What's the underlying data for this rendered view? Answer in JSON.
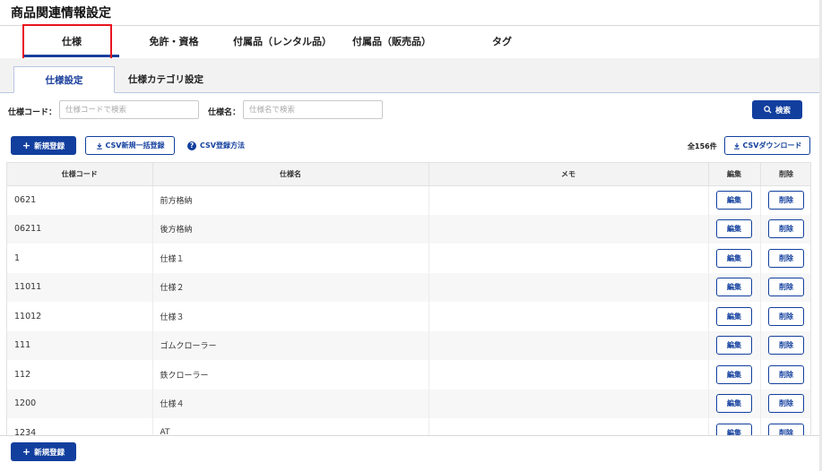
{
  "page": {
    "title": "商品関連情報設定"
  },
  "top_tabs": [
    {
      "label": "仕様"
    },
    {
      "label": "免許・資格"
    },
    {
      "label": "付属品（レンタル品）"
    },
    {
      "label": "付属品（販売品）"
    },
    {
      "label": "タグ"
    }
  ],
  "sub_tabs": [
    {
      "label": "仕様設定"
    },
    {
      "label": "仕様カテゴリ設定"
    }
  ],
  "search": {
    "code_label": "仕様コード：",
    "code_placeholder": "仕様コードで検索",
    "name_label": "仕様名：",
    "name_placeholder": "仕様名で検索",
    "button_label": "検索"
  },
  "toolbar": {
    "new_label": "新規登録",
    "csv_bulk_label": "CSV新規一括登録",
    "csv_help_label": "CSV登録方法",
    "count_text": "全156件",
    "csv_download_label": "CSVダウンロード"
  },
  "table": {
    "headers": {
      "code": "仕様コード",
      "name": "仕様名",
      "memo": "メモ",
      "edit": "編集",
      "delete": "削除"
    },
    "edit_label": "編集",
    "delete_label": "削除",
    "rows": [
      {
        "code": "0621",
        "name": "前方格納",
        "memo": ""
      },
      {
        "code": "06211",
        "name": "後方格納",
        "memo": ""
      },
      {
        "code": "1",
        "name": "仕様１",
        "memo": ""
      },
      {
        "code": "11011",
        "name": "仕様２",
        "memo": ""
      },
      {
        "code": "11012",
        "name": "仕様３",
        "memo": ""
      },
      {
        "code": "111",
        "name": "ゴムクローラー",
        "memo": ""
      },
      {
        "code": "112",
        "name": "鉄クローラー",
        "memo": ""
      },
      {
        "code": "1200",
        "name": "仕様４",
        "memo": ""
      },
      {
        "code": "1234",
        "name": "AT",
        "memo": ""
      }
    ]
  },
  "footer": {
    "new_label": "新規登録"
  },
  "icons": {
    "plus": "plus-icon",
    "download": "download-icon",
    "help": "help-icon",
    "search": "search-icon"
  },
  "colors": {
    "primary": "#123f9e",
    "highlight": "#e8141f"
  }
}
